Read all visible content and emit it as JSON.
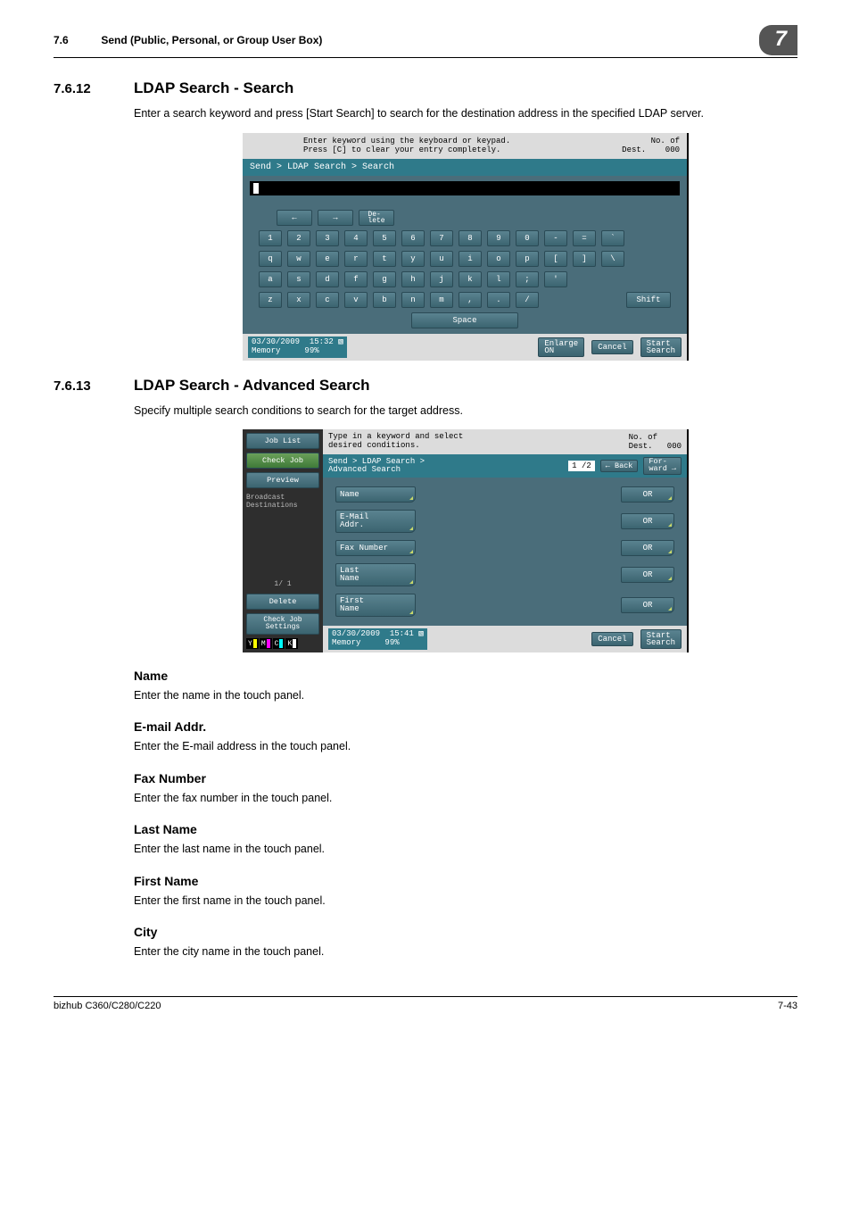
{
  "header": {
    "section_no": "7.6",
    "section_title": "Send (Public, Personal, or Group User Box)",
    "chapter_badge": "7"
  },
  "s1": {
    "num": "7.6.12",
    "title": "LDAP Search - Search",
    "para": "Enter a search keyword and press [Start Search] to search for the destination address in the specified LDAP server."
  },
  "scr1": {
    "msg1": "Enter keyword using the keyboard or keypad.",
    "msg2": "Press [C] to clear your entry completely.",
    "dest_label": "No. of\nDest.",
    "dest_count": "000",
    "breadcrumb": "Send > LDAP Search > Search",
    "arrow_left": "←",
    "arrow_right": "→",
    "delete_key": "De-\nlete",
    "row1": [
      "1",
      "2",
      "3",
      "4",
      "5",
      "6",
      "7",
      "8",
      "9",
      "0",
      "-",
      "=",
      "`"
    ],
    "row2": [
      "q",
      "w",
      "e",
      "r",
      "t",
      "y",
      "u",
      "i",
      "o",
      "p",
      "[",
      "]",
      "\\"
    ],
    "row3": [
      "a",
      "s",
      "d",
      "f",
      "g",
      "h",
      "j",
      "k",
      "l",
      ";",
      "'"
    ],
    "row4": [
      "z",
      "x",
      "c",
      "v",
      "b",
      "n",
      "m",
      ",",
      ".",
      "/"
    ],
    "shift": "Shift",
    "space": "Space",
    "date": "03/30/2009",
    "time": "15:32",
    "memory": "Memory",
    "mem_pct": "99%",
    "enlarge": "Enlarge\nON",
    "cancel": "Cancel",
    "start": "Start\nSearch"
  },
  "s2": {
    "num": "7.6.13",
    "title": "LDAP Search - Advanced Search",
    "para": "Specify multiple search conditions to search for the target address."
  },
  "scr2": {
    "job_list": "Job List",
    "check_job": "Check Job",
    "preview": "Preview",
    "broadcast": "Broadcast\nDestinations",
    "page_ind": "1/  1",
    "delete": "Delete",
    "check_set": "Check Job\nSettings",
    "msg1": "Type in a keyword and select",
    "msg2": "desired conditions.",
    "dest_label": "No. of\nDest.",
    "dest_count": "000",
    "crumb": "Send > LDAP Search >\nAdvanced Search",
    "page": "1 /2",
    "back": "Back",
    "forward": "For-\nward",
    "f_name": "Name",
    "f_email": "E-Mail\nAddr.",
    "f_fax": "Fax Number",
    "f_last": "Last\nName",
    "f_first": "First\nName",
    "or": "OR",
    "date": "03/30/2009",
    "time": "15:41",
    "memory": "Memory",
    "mem_pct": "99%",
    "cancel": "Cancel",
    "start": "Start\nSearch"
  },
  "fields": {
    "name_h": "Name",
    "name_p": "Enter the name in the touch panel.",
    "email_h": "E-mail Addr.",
    "email_p": "Enter the E-mail address in the touch panel.",
    "fax_h": "Fax Number",
    "fax_p": "Enter the fax number in the touch panel.",
    "last_h": "Last Name",
    "last_p": "Enter the last name in the touch panel.",
    "first_h": "First Name",
    "first_p": "Enter the first name in the touch panel.",
    "city_h": "City",
    "city_p": "Enter the city name in the touch panel."
  },
  "footer": {
    "model": "bizhub C360/C280/C220",
    "page": "7-43"
  }
}
